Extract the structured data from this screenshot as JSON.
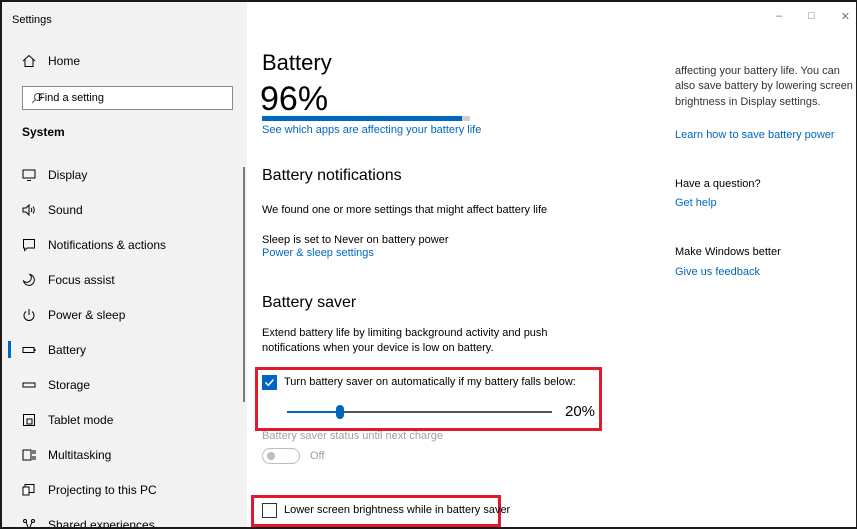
{
  "window": {
    "title": "Settings",
    "controls": {
      "minimize": "–",
      "maximize": "□",
      "close": "✕"
    }
  },
  "sidebar": {
    "home_label": "Home",
    "search_placeholder": "Find a setting",
    "section_title": "System",
    "items": [
      {
        "label": "Display",
        "icon": "monitor-icon"
      },
      {
        "label": "Sound",
        "icon": "speaker-icon"
      },
      {
        "label": "Notifications & actions",
        "icon": "notifications-icon"
      },
      {
        "label": "Focus assist",
        "icon": "moon-icon"
      },
      {
        "label": "Power & sleep",
        "icon": "power-icon"
      },
      {
        "label": "Battery",
        "icon": "battery-icon",
        "active": true
      },
      {
        "label": "Storage",
        "icon": "storage-icon"
      },
      {
        "label": "Tablet mode",
        "icon": "tablet-icon"
      },
      {
        "label": "Multitasking",
        "icon": "multitasking-icon"
      },
      {
        "label": "Projecting to this PC",
        "icon": "projector-icon"
      },
      {
        "label": "Shared experiences",
        "icon": "shared-icon"
      }
    ]
  },
  "main": {
    "title": "Battery",
    "percent": "96%",
    "charge_fraction": 0.96,
    "apps_link": "See which apps are affecting your battery life",
    "notifications": {
      "title": "Battery notifications",
      "found": "We found one or more settings that might affect battery life",
      "sleep": "Sleep is set to Never on battery power",
      "link": "Power & sleep settings"
    },
    "saver": {
      "title": "Battery saver",
      "description": "Extend battery life by limiting background activity and push notifications when your device is low on battery.",
      "auto_label": "Turn battery saver on automatically if my battery falls below:",
      "auto_checked": true,
      "threshold": "20%",
      "threshold_fraction": 0.2,
      "status_until": "Battery saver status until next charge",
      "toggle_state": "Off",
      "brightness_label": "Lower screen brightness while in battery saver",
      "brightness_checked": false
    }
  },
  "right_panel": {
    "clipped_line": "affecting your battery life. You can also save battery by lowering screen brightness in Display settings.",
    "save_link": "Learn how to save battery power",
    "question": "Have a question?",
    "help_link": "Get help",
    "better": "Make Windows better",
    "feedback_link": "Give us feedback"
  },
  "colors": {
    "accent": "#0067c0",
    "highlight_box": "#e0192c",
    "sidebar_bg": "#f2f2f2"
  }
}
